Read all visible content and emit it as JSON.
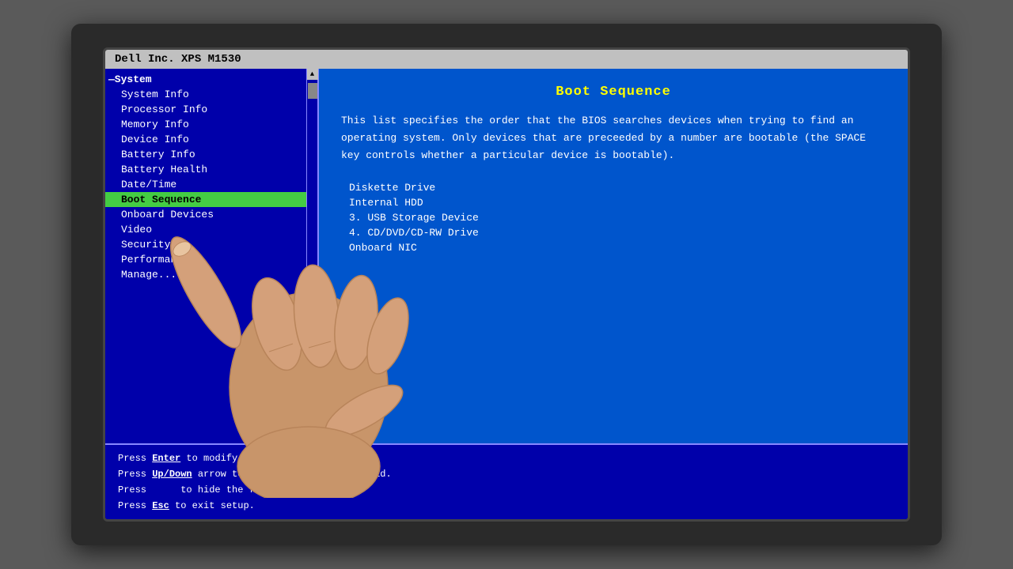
{
  "titleBar": {
    "text": "Dell Inc. XPS M1530"
  },
  "leftPanel": {
    "items": [
      {
        "id": "system-header",
        "label": "System",
        "type": "section-header",
        "prefix": "—"
      },
      {
        "id": "system-info",
        "label": "System Info",
        "type": "sub-item"
      },
      {
        "id": "processor-info",
        "label": "Processor Info",
        "type": "sub-item"
      },
      {
        "id": "memory-info",
        "label": "Memory Info",
        "type": "sub-item"
      },
      {
        "id": "device-info",
        "label": "Device Info",
        "type": "sub-item"
      },
      {
        "id": "battery-info",
        "label": "Battery Info",
        "type": "sub-item"
      },
      {
        "id": "battery-health",
        "label": "Battery Health",
        "type": "sub-item"
      },
      {
        "id": "datetime",
        "label": "Date/Time",
        "type": "sub-item"
      },
      {
        "id": "boot-sequence",
        "label": "Boot Sequence",
        "type": "sub-item",
        "selected": true
      },
      {
        "id": "onboard-devices",
        "label": "Onboard Devices",
        "type": "sub-item"
      },
      {
        "id": "video",
        "label": "Video",
        "type": "sub-item"
      },
      {
        "id": "security",
        "label": "Security",
        "type": "sub-item"
      },
      {
        "id": "performance",
        "label": "Performance",
        "type": "sub-item"
      },
      {
        "id": "manage",
        "label": "Manage...",
        "type": "sub-item"
      }
    ]
  },
  "rightPanel": {
    "title": "Boot Sequence",
    "description": "This list specifies the order that the BIOS searches devices when trying to find an operating system. Only devices that are preceeded by a number are bootable (the SPACE key controls whether a particular device is bootable).",
    "bootItems": [
      {
        "id": "diskette",
        "label": "Diskette Drive",
        "number": ""
      },
      {
        "id": "internal-hdd",
        "label": "Internal HDD",
        "number": ""
      },
      {
        "id": "usb-storage",
        "label": "USB Storage Device",
        "number": "3."
      },
      {
        "id": "cddvd",
        "label": "CD/DVD/CD-RW Drive",
        "number": "4."
      },
      {
        "id": "onboard-nic",
        "label": "Onboard NIC",
        "number": ""
      }
    ]
  },
  "statusBar": {
    "lines": [
      {
        "prefix": "Press ",
        "key": "Enter",
        "suffix": " to modify this setting."
      },
      {
        "prefix": "Press ",
        "key": "Up/Down",
        "suffix": " arrow to select a different field."
      },
      {
        "prefix": "Press ",
        "key": "",
        "suffix": " to hide the fields in this group"
      },
      {
        "prefix": "Press ",
        "key": "Esc",
        "suffix": " to exit setup."
      }
    ]
  },
  "colors": {
    "selectedBg": "#44cc44",
    "selectedFg": "#000000",
    "panelBg": "#0000aa",
    "contentBg": "#0055cc",
    "titleColor": "#ffff00",
    "textColor": "#ffffff"
  }
}
